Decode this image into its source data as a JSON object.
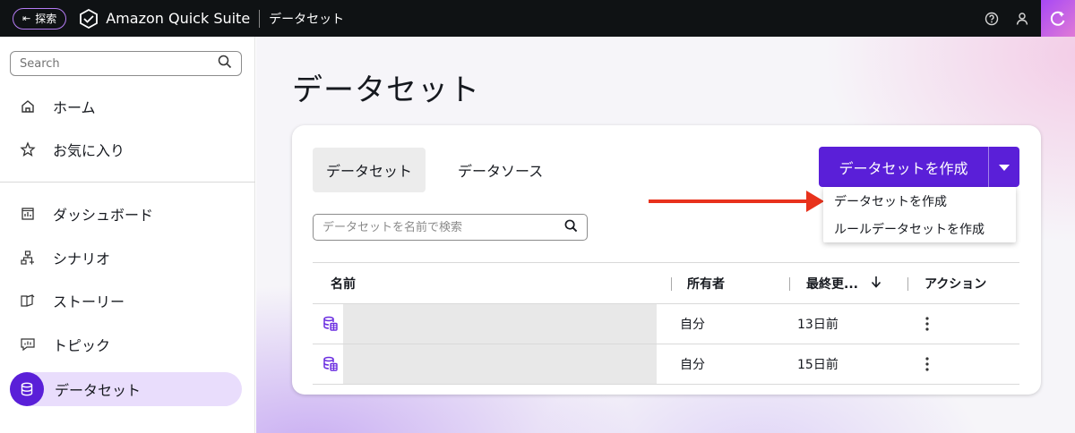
{
  "topbar": {
    "explore_label": "探索",
    "app_name": "Amazon Quick Suite",
    "breadcrumb": "データセット",
    "icons": [
      "help-icon",
      "user-icon",
      "assistant-icon"
    ]
  },
  "sidebar": {
    "search_placeholder": "Search",
    "items": [
      {
        "label": "ホーム",
        "icon": "home-icon"
      },
      {
        "label": "お気に入り",
        "icon": "star-icon"
      },
      {
        "label": "ダッシュボード",
        "icon": "dashboard-icon"
      },
      {
        "label": "シナリオ",
        "icon": "scenario-icon"
      },
      {
        "label": "ストーリー",
        "icon": "story-icon"
      },
      {
        "label": "トピック",
        "icon": "topic-icon"
      },
      {
        "label": "データセット",
        "icon": "database-icon",
        "active": true
      }
    ]
  },
  "main": {
    "title": "データセット",
    "tabs": [
      {
        "label": "データセット",
        "active": true
      },
      {
        "label": "データソース",
        "active": false
      }
    ],
    "search_placeholder": "データセットを名前で検索",
    "create_button": "データセットを作成",
    "dropdown": [
      "データセットを作成",
      "ルールデータセットを作成"
    ],
    "table": {
      "headers": [
        "名前",
        "所有者",
        "最終更...",
        "アクション"
      ],
      "rows": [
        {
          "name": "",
          "owner": "自分",
          "updated": "13日前"
        },
        {
          "name": "",
          "owner": "自分",
          "updated": "15日前"
        }
      ]
    }
  },
  "colors": {
    "primary": "#5a1fd8",
    "active_nav_bg": "#e9ddfc",
    "annotation_arrow": "#e8321c",
    "topbar_bg": "#0f1214"
  }
}
